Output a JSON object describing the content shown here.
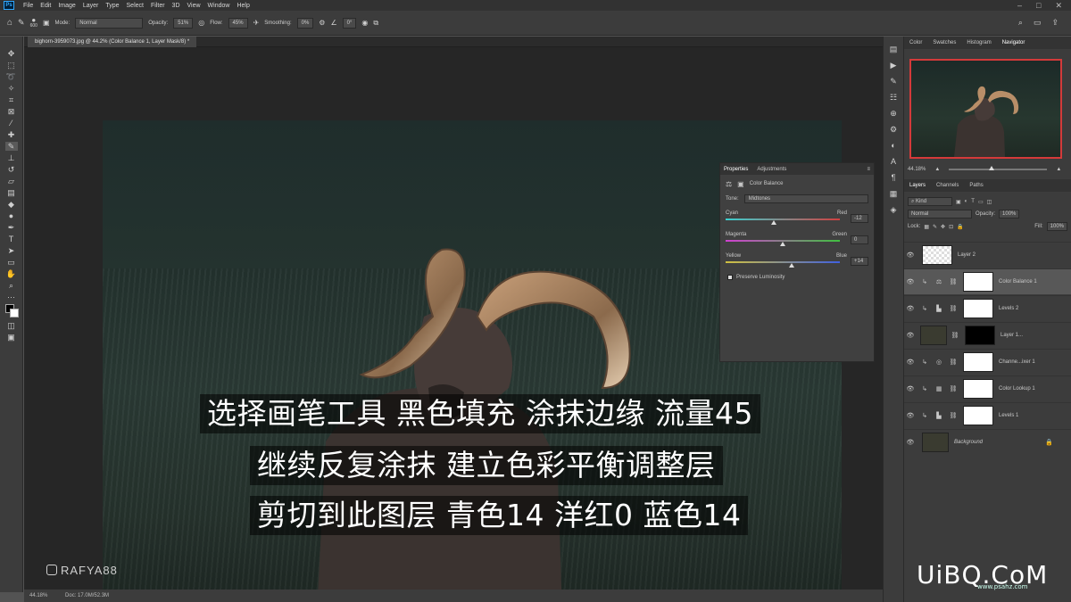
{
  "menubar": {
    "items": [
      "File",
      "Edit",
      "Image",
      "Layer",
      "Type",
      "Select",
      "Filter",
      "3D",
      "View",
      "Window",
      "Help"
    ]
  },
  "options": {
    "brush_size": "600",
    "mode_label": "Mode:",
    "mode_value": "Normal",
    "opacity_label": "Opacity:",
    "opacity_value": "51%",
    "flow_label": "Flow:",
    "flow_value": "45%",
    "smoothing_label": "Smoothing:",
    "smoothing_value": "0%",
    "angle_value": "0°"
  },
  "document": {
    "tab_title": "bighorn-3959073.jpg @ 44.2% (Color Balance 1, Layer Mask/8) *"
  },
  "captions": [
    "选择画笔工具 黑色填充 涂抹边缘 流量45",
    "继续反复涂抹  建立色彩平衡调整层",
    "剪切到此图层 青色14 洋红0 蓝色14"
  ],
  "watermark_ig": "RAFYA88",
  "statusbar": {
    "zoom": "44.18%",
    "doc": "Doc: 17.0M/52.3M"
  },
  "properties": {
    "tabs": [
      "Properties",
      "Adjustments"
    ],
    "adj_title": "Color Balance",
    "tone_label": "Tone:",
    "tone_value": "Midtones",
    "sliders": [
      {
        "left": "Cyan",
        "right": "Red",
        "value": "-12",
        "pos": 0.42,
        "gradient": [
          "#3ad0d0",
          "#d04040"
        ]
      },
      {
        "left": "Magenta",
        "right": "Green",
        "value": "0",
        "pos": 0.5,
        "gradient": [
          "#d040d0",
          "#40c040"
        ]
      },
      {
        "left": "Yellow",
        "right": "Blue",
        "value": "+14",
        "pos": 0.58,
        "gradient": [
          "#d0c040",
          "#4060e0"
        ]
      }
    ],
    "preserve_label": "Preserve Luminosity"
  },
  "navigator": {
    "tabs": [
      "Color",
      "Swatches",
      "Histogram",
      "Navigator"
    ],
    "zoom": "44.18%"
  },
  "layers": {
    "tabs": [
      "Layers",
      "Channels",
      "Paths"
    ],
    "filter_kind": "Kind",
    "blend_mode": "Normal",
    "opacity_label": "Opacity:",
    "opacity_value": "100%",
    "lock_label": "Lock:",
    "fill_label": "Fill:",
    "fill_value": "100%",
    "items": [
      {
        "name": "Layer 2"
      },
      {
        "name": "Color Balance 1"
      },
      {
        "name": "Levels 2"
      },
      {
        "name": "Layer 1..."
      },
      {
        "name": "Channe...ixer 1"
      },
      {
        "name": "Color Lookup 1"
      },
      {
        "name": "Levels 1"
      },
      {
        "name": "Background"
      }
    ]
  },
  "site_watermark": "UiBQ.CoM",
  "site_sub": "www.psahz.com"
}
